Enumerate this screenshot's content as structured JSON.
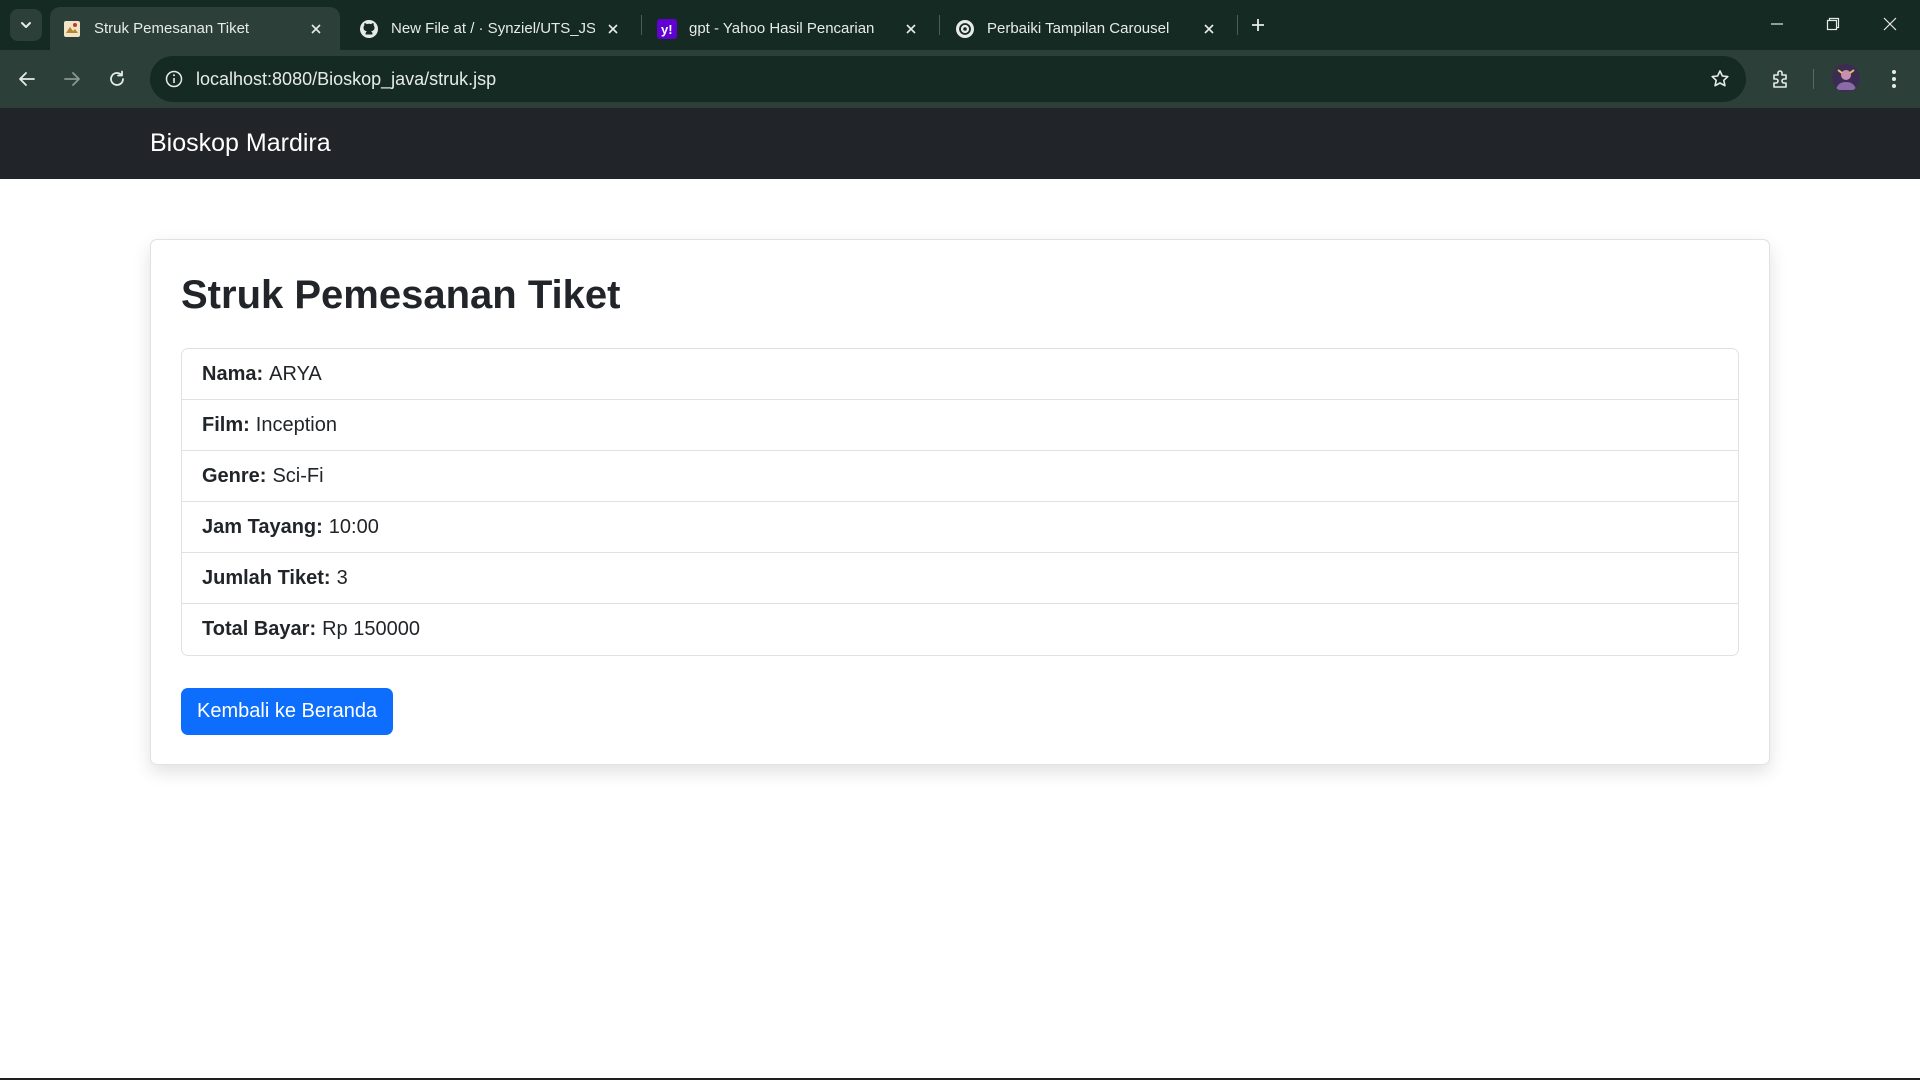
{
  "browser": {
    "tabs": [
      {
        "title": "Struk Pemesanan Tiket",
        "favicon": "cinema-icon",
        "active": true
      },
      {
        "title": "New File at / · Synziel/UTS_JSP_",
        "favicon": "github-icon",
        "active": false
      },
      {
        "title": "gpt - Yahoo Hasil Pencarian",
        "favicon": "yahoo-icon",
        "active": false
      },
      {
        "title": "Perbaiki Tampilan Carousel",
        "favicon": "openai-icon",
        "active": false
      }
    ],
    "url": "localhost:8080/Bioskop_java/struk.jsp",
    "colors": {
      "frame": "#162a24",
      "toolbar": "#2c3f39"
    }
  },
  "page": {
    "brand": "Bioskop Mardira",
    "heading": "Struk Pemesanan Tiket",
    "details": [
      {
        "label": "Nama:",
        "value": "ARYA"
      },
      {
        "label": "Film:",
        "value": "Inception"
      },
      {
        "label": "Genre:",
        "value": "Sci-Fi"
      },
      {
        "label": "Jam Tayang:",
        "value": "10:00"
      },
      {
        "label": "Jumlah Tiket:",
        "value": "3"
      },
      {
        "label": "Total Bayar:",
        "value": "Rp 150000"
      }
    ],
    "back_button": "Kembali ke Beranda",
    "colors": {
      "navbar": "#212529",
      "primary": "#0d6efd"
    }
  }
}
